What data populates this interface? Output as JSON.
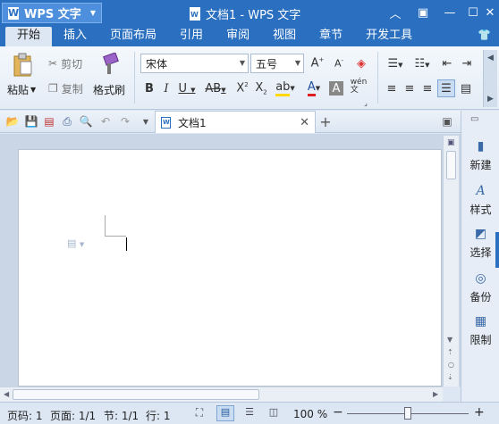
{
  "app": {
    "name": "WPS 文字",
    "doc_title": "文档1 - WPS 文字"
  },
  "tabs": [
    "开始",
    "插入",
    "页面布局",
    "引用",
    "审阅",
    "视图",
    "章节",
    "开发工具"
  ],
  "clipboard": {
    "paste": "粘贴",
    "cut": "剪切",
    "copy": "复制",
    "format_painter": "格式刷"
  },
  "font": {
    "family": "宋体",
    "size": "五号"
  },
  "doc_tab": {
    "name": "文档1"
  },
  "side": {
    "new": "新建",
    "style": "样式",
    "select": "选择",
    "backup": "备份",
    "limit": "限制"
  },
  "status": {
    "page": "页码: 1",
    "pages": "页面: 1/1",
    "section": "节: 1/1",
    "line": "行: 1",
    "zoom": "100 %"
  },
  "colors": {
    "title_bg": "#2a6fc0",
    "highlight": "#ffd800",
    "font_color": "#e02020"
  }
}
